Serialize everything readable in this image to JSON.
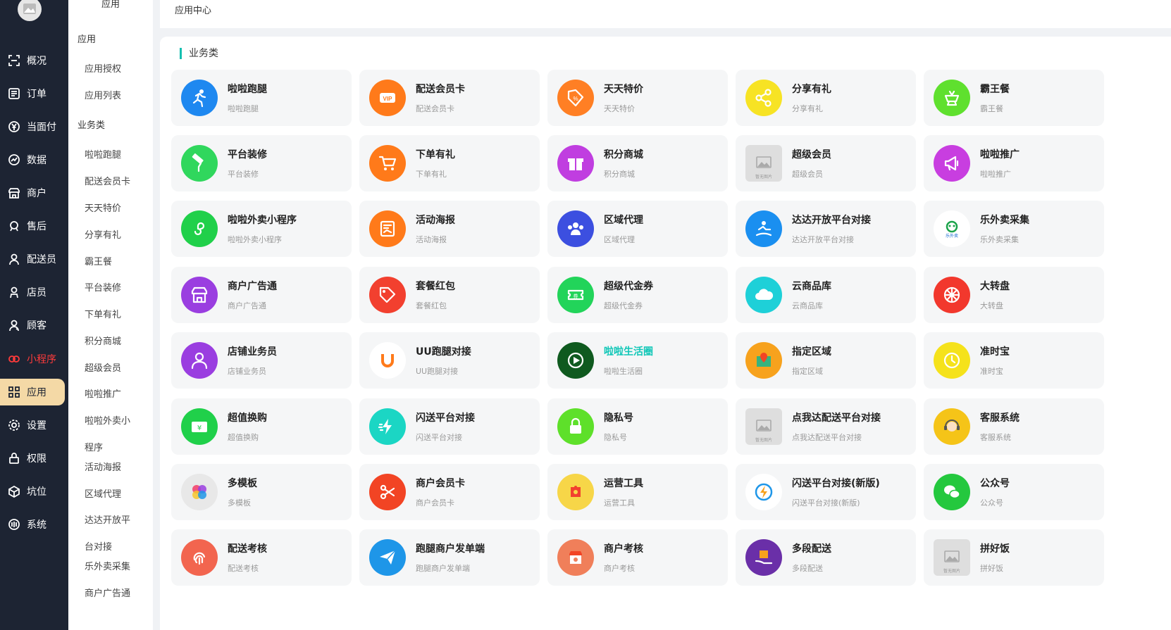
{
  "nav": {
    "items": [
      {
        "label": "概况",
        "icon": "overview-icon"
      },
      {
        "label": "订单",
        "icon": "order-icon"
      },
      {
        "label": "当面付",
        "icon": "yuan-icon"
      },
      {
        "label": "数据",
        "icon": "chart-icon"
      },
      {
        "label": "商户",
        "icon": "store-icon"
      },
      {
        "label": "售后",
        "icon": "service-icon"
      },
      {
        "label": "配送员",
        "icon": "courier-icon"
      },
      {
        "label": "店员",
        "icon": "clerk-icon"
      },
      {
        "label": "顾客",
        "icon": "customer-icon"
      },
      {
        "label": "小程序",
        "icon": "mini-program-icon"
      },
      {
        "label": "应用",
        "icon": "apps-icon"
      },
      {
        "label": "设置",
        "icon": "gear-icon"
      },
      {
        "label": "权限",
        "icon": "lock-icon"
      },
      {
        "label": "坑位",
        "icon": "box-icon"
      },
      {
        "label": "系统",
        "icon": "system-icon"
      }
    ],
    "active_color": "#f4d9a6",
    "highlight_color": "#ff3b3b"
  },
  "submenu": {
    "top_label": "应用",
    "group1": "应用",
    "group1_items": [
      "应用授权",
      "应用列表"
    ],
    "group2": "业务类",
    "group2_items": [
      "啦啦跑腿",
      "配送会员卡",
      "天天特价",
      "分享有礼",
      "霸王餐",
      "平台装修",
      "下单有礼",
      "积分商城",
      "超级会员",
      "啦啦推广",
      "啦啦外卖小",
      "程序",
      "活动海报",
      "区域代理",
      "达达开放平",
      "台对接",
      "乐外卖采集",
      "商户广告通"
    ]
  },
  "header": {
    "title": "应用中心"
  },
  "main": {
    "section_title": "业务类",
    "accent": "#15bfb0",
    "cards": [
      {
        "name": "啦啦跑腿",
        "desc": "啦啦跑腿",
        "icon": "runner-icon",
        "color": "#1e88f0"
      },
      {
        "name": "配送会员卡",
        "desc": "配送会员卡",
        "icon": "vip-icon",
        "color": "#ff7a1a"
      },
      {
        "name": "天天特价",
        "desc": "天天特价",
        "icon": "price-tag-icon",
        "color": "#ff7f24"
      },
      {
        "name": "分享有礼",
        "desc": "分享有礼",
        "icon": "share-icon",
        "color": "#f7e324"
      },
      {
        "name": "霸王餐",
        "desc": "霸王餐",
        "icon": "meal-icon",
        "color": "#5fe02e"
      },
      {
        "name": "平台装修",
        "desc": "平台装修",
        "icon": "paint-roller-icon",
        "color": "#30d75d"
      },
      {
        "name": "下单有礼",
        "desc": "下单有礼",
        "icon": "cart-icon",
        "color": "#ff7a1a"
      },
      {
        "name": "积分商城",
        "desc": "积分商城",
        "icon": "gift-icon",
        "color": "#c03ee0"
      },
      {
        "name": "超级会员",
        "desc": "超级会员",
        "icon": "placeholder-image-icon",
        "color": "#dedede"
      },
      {
        "name": "啦啦推广",
        "desc": "啦啦推广",
        "icon": "megaphone-icon",
        "color": "#c83ee0"
      },
      {
        "name": "啦啦外卖小程序",
        "desc": "啦啦外卖小程序",
        "icon": "mini-program-logo-icon",
        "color": "#20d04a"
      },
      {
        "name": "活动海报",
        "desc": "活动海报",
        "icon": "poster-icon",
        "color": "#ff7a1a"
      },
      {
        "name": "区域代理",
        "desc": "区域代理",
        "icon": "group-icon",
        "color": "#3c4fe0"
      },
      {
        "name": "达达开放平台对接",
        "desc": "达达开放平台对接",
        "icon": "delivery-rider-icon",
        "color": "#1a8ff0"
      },
      {
        "name": "乐外卖采集",
        "desc": "乐外卖采集",
        "icon": "lewaimai-logo-icon",
        "color": "#ffffff"
      },
      {
        "name": "商户广告通",
        "desc": "商户广告通",
        "icon": "shop-front-icon",
        "color": "#9a3ee0"
      },
      {
        "name": "套餐红包",
        "desc": "套餐红包",
        "icon": "red-packet-tag-icon",
        "color": "#f2402f"
      },
      {
        "name": "超级代金券",
        "desc": "超级代金券",
        "icon": "coupon-icon",
        "color": "#22d45a"
      },
      {
        "name": "云商品库",
        "desc": "云商品库",
        "icon": "cloud-icon",
        "color": "#1ed0d8"
      },
      {
        "name": "大转盘",
        "desc": "大转盘",
        "icon": "wheel-icon",
        "color": "#f2382d"
      },
      {
        "name": "店铺业务员",
        "desc": "店铺业务员",
        "icon": "person-icon",
        "color": "#9a3ee0"
      },
      {
        "name": "UU跑腿对接",
        "desc": "UU跑腿对接",
        "icon": "uu-logo-icon",
        "color": "#ffffff"
      },
      {
        "name": "啦啦生活圈",
        "desc": "啦啦生活圈",
        "icon": "play-circle-icon",
        "color": "#0f5a1f"
      },
      {
        "name": "指定区域",
        "desc": "指定区域",
        "icon": "map-pin-icon",
        "color": "#f7a21d"
      },
      {
        "name": "准时宝",
        "desc": "准时宝",
        "icon": "clock-icon",
        "color": "#f5e21b"
      },
      {
        "name": "超值换购",
        "desc": "超值换购",
        "icon": "yuan-ticket-icon",
        "color": "#20d04a"
      },
      {
        "name": "闪送平台对接",
        "desc": "闪送平台对接",
        "icon": "flash-delivery-icon",
        "color": "#1bd6c4"
      },
      {
        "name": "隐私号",
        "desc": "隐私号",
        "icon": "padlock-icon",
        "color": "#5ee02a"
      },
      {
        "name": "点我达配送平台对接",
        "desc": "点我达配送平台对接",
        "icon": "placeholder-image-icon",
        "color": "#dedede"
      },
      {
        "name": "客服系统",
        "desc": "客服系统",
        "icon": "support-agent-icon",
        "color": "#f5c418"
      },
      {
        "name": "多模板",
        "desc": "多模板",
        "icon": "palette-icon",
        "color": "#e8e8e8"
      },
      {
        "name": "商户会员卡",
        "desc": "商户会员卡",
        "icon": "scissors-icon",
        "color": "#f24424"
      },
      {
        "name": "运营工具",
        "desc": "运营工具",
        "icon": "puzzle-icon",
        "color": "#f7d648"
      },
      {
        "name": "闪送平台对接(新版)",
        "desc": "闪送平台对接(新版)",
        "icon": "lightning-ring-icon",
        "color": "#ffffff"
      },
      {
        "name": "公众号",
        "desc": "公众号",
        "icon": "wechat-icon",
        "color": "#24c83e"
      },
      {
        "name": "配送考核",
        "desc": "配送考核",
        "icon": "fingerprint-icon",
        "color": "#f2654f"
      },
      {
        "name": "跑腿商户发单端",
        "desc": "跑腿商户发单端",
        "icon": "paper-plane-icon",
        "color": "#1e96e8"
      },
      {
        "name": "商户考核",
        "desc": "商户考核",
        "icon": "shop-assess-icon",
        "color": "#f07f5a"
      },
      {
        "name": "多段配送",
        "desc": "多段配送",
        "icon": "parcel-hand-icon",
        "color": "#6a2fa8"
      },
      {
        "name": "拼好饭",
        "desc": "拼好饭",
        "icon": "placeholder-image-icon",
        "color": "#dedede"
      }
    ],
    "placeholder_caption": "暂无图片",
    "highlighted_card": "啦啦生活圈"
  }
}
